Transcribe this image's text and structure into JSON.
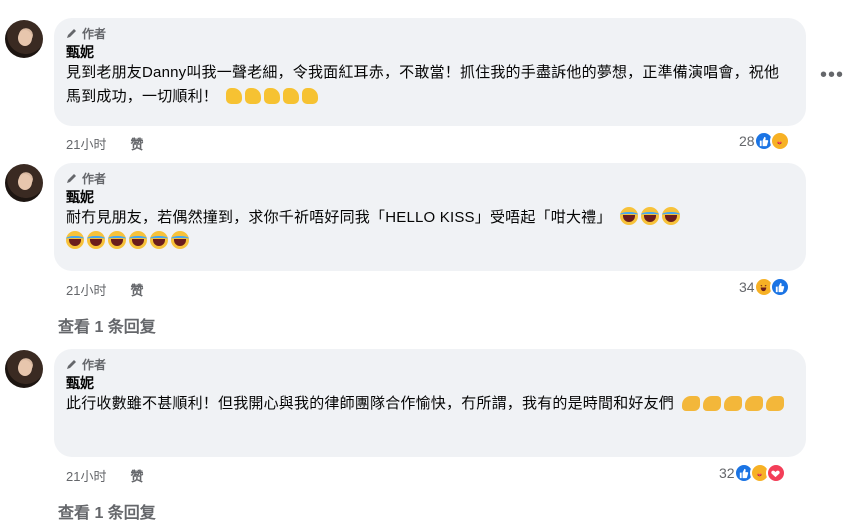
{
  "comments": [
    {
      "badge": "作者",
      "name": "甄妮",
      "text": "見到老朋友Danny叫我一聲老細，令我面紅耳赤，不敢當！抓住我的手盡訴他的夢想，正準備演唱會，祝他馬到成功，一切順利！",
      "emoji": "thumbs-up",
      "emoji_count": 5,
      "time": "21小时",
      "like_label": "赞",
      "reaction_count": "28",
      "reactions": [
        "like",
        "care"
      ]
    },
    {
      "badge": "作者",
      "name": "甄妮",
      "text": "耐冇見朋友，若偶然撞到，求你千祈唔好同我「HELLO KISS」受唔起「咁大禮」",
      "emoji": "tears-of-joy",
      "emoji_count": 9,
      "time": "21小时",
      "like_label": "赞",
      "reaction_count": "34",
      "reactions": [
        "haha",
        "like"
      ],
      "view_replies": "查看 1 条回复"
    },
    {
      "badge": "作者",
      "name": "甄妮",
      "text": "此行收數雖不甚順利！但我開心與我的律師團隊合作愉快，冇所謂，我有的是時間和好友們",
      "emoji": "flexed-biceps",
      "emoji_count": 5,
      "time": "21小时",
      "like_label": "赞",
      "reaction_count": "32",
      "reactions": [
        "like",
        "care",
        "love"
      ],
      "view_replies": "查看 1 条回复"
    }
  ],
  "icons": {
    "badge": "pencil-icon",
    "more": "more-options-icon"
  },
  "colors": {
    "bubble": "#f0f2f5",
    "like_blue": "#1b74e4",
    "love_red": "#f33e58",
    "secondary_text": "#65676b"
  }
}
